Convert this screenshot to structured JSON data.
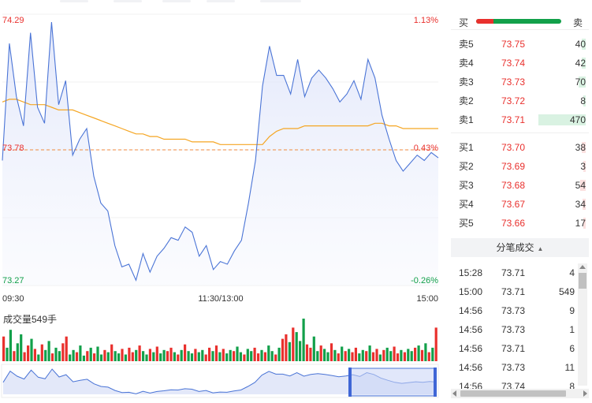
{
  "chart_data": {
    "type": "line",
    "price_axis": {
      "max_label": "74.29",
      "ref_label": "73.78",
      "min_label": "73.27"
    },
    "pct_axis": {
      "max_label": "1.13%",
      "ref_label": "0.43%",
      "min_label": "-0.26%"
    },
    "time_labels": [
      "09:30",
      "11:30/13:00",
      "15:00"
    ],
    "ylim": [
      73.27,
      74.29
    ],
    "reference_price": 73.78,
    "colors": {
      "price": "#4a74d6",
      "avg": "#f5a623",
      "up": "#e9302d",
      "down": "#12a04a",
      "ref": "#f08a3c",
      "fill": "#e9edfb"
    },
    "price_series": [
      73.74,
      74.18,
      73.98,
      73.87,
      74.22,
      73.94,
      73.88,
      74.26,
      73.95,
      74.04,
      73.76,
      73.82,
      73.86,
      73.68,
      73.58,
      73.55,
      73.42,
      73.34,
      73.35,
      73.29,
      73.39,
      73.32,
      73.38,
      73.41,
      73.45,
      73.44,
      73.49,
      73.47,
      73.38,
      73.42,
      73.33,
      73.36,
      73.35,
      73.4,
      73.44,
      73.58,
      73.74,
      74.02,
      74.17,
      74.06,
      74.06,
      73.99,
      74.12,
      73.98,
      74.05,
      74.08,
      74.05,
      74.01,
      73.96,
      73.99,
      74.04,
      73.97,
      74.12,
      74.05,
      73.91,
      73.82,
      73.74,
      73.7,
      73.73,
      73.76,
      73.74,
      73.77,
      73.75
    ],
    "avg_series": [
      73.96,
      73.97,
      73.97,
      73.96,
      73.95,
      73.95,
      73.95,
      73.94,
      73.93,
      73.93,
      73.93,
      73.92,
      73.91,
      73.9,
      73.89,
      73.88,
      73.87,
      73.86,
      73.85,
      73.84,
      73.84,
      73.83,
      73.83,
      73.82,
      73.82,
      73.82,
      73.82,
      73.81,
      73.81,
      73.81,
      73.81,
      73.8,
      73.8,
      73.8,
      73.8,
      73.8,
      73.8,
      73.8,
      73.83,
      73.85,
      73.86,
      73.86,
      73.86,
      73.87,
      73.87,
      73.87,
      73.87,
      73.87,
      73.87,
      73.87,
      73.87,
      73.87,
      73.87,
      73.88,
      73.88,
      73.87,
      73.87,
      73.86,
      73.86,
      73.86,
      73.86,
      73.86,
      73.86
    ],
    "volume": {
      "title": "成交量549手",
      "values": [
        22,
        12,
        28,
        9,
        16,
        24,
        8,
        14,
        20,
        11,
        6,
        15,
        10,
        18,
        7,
        12,
        9,
        16,
        22,
        6,
        10,
        8,
        14,
        5,
        9,
        12,
        7,
        13,
        6,
        10,
        8,
        15,
        9,
        7,
        11,
        6,
        12,
        8,
        10,
        14,
        9,
        6,
        11,
        8,
        13,
        7,
        10,
        9,
        12,
        8,
        6,
        10,
        15,
        9,
        7,
        11,
        8,
        10,
        6,
        12,
        9,
        14,
        8,
        11,
        7,
        10,
        9,
        13,
        8,
        6,
        11,
        9,
        12,
        7,
        10,
        8,
        14,
        9,
        6,
        12,
        20,
        24,
        17,
        30,
        26,
        18,
        38,
        15,
        12,
        22,
        9,
        14,
        11,
        8,
        16,
        10,
        7,
        13,
        9,
        11,
        8,
        12,
        7,
        10,
        9,
        14,
        8,
        11,
        6,
        10,
        12,
        9,
        13,
        7,
        10,
        8,
        11,
        9,
        12,
        14,
        10,
        16,
        8,
        12,
        30
      ],
      "directions": "uddudduudududdudduudduddududdududduduududdududduudududdudduudududduddudduududduduududdduudduddudududuudduduududduududdudududududdu"
    }
  },
  "book": {
    "buy_label": "买",
    "sell_label": "卖",
    "buy_ratio": 0.2,
    "asks": [
      {
        "label": "卖5",
        "price": "73.75",
        "vol": "40"
      },
      {
        "label": "卖4",
        "price": "73.74",
        "vol": "42"
      },
      {
        "label": "卖3",
        "price": "73.73",
        "vol": "70"
      },
      {
        "label": "卖2",
        "price": "73.72",
        "vol": "8"
      },
      {
        "label": "卖1",
        "price": "73.71",
        "vol": "470"
      }
    ],
    "bids": [
      {
        "label": "买1",
        "price": "73.70",
        "vol": "38"
      },
      {
        "label": "买2",
        "price": "73.69",
        "vol": "3"
      },
      {
        "label": "买3",
        "price": "73.68",
        "vol": "54"
      },
      {
        "label": "买4",
        "price": "73.67",
        "vol": "34"
      },
      {
        "label": "买5",
        "price": "73.66",
        "vol": "17"
      }
    ]
  },
  "trades": {
    "title": "分笔成交",
    "sort_icon": "caret-up-icon",
    "rows": [
      {
        "time": "15:28",
        "price": "73.71",
        "vol": "4"
      },
      {
        "time": "15:00",
        "price": "73.71",
        "vol": "549"
      },
      {
        "time": "14:56",
        "price": "73.73",
        "vol": "9"
      },
      {
        "time": "14:56",
        "price": "73.73",
        "vol": "1"
      },
      {
        "time": "14:56",
        "price": "73.71",
        "vol": "6"
      },
      {
        "time": "14:56",
        "price": "73.73",
        "vol": "11"
      },
      {
        "time": "14:56",
        "price": "73.74",
        "vol": "8"
      }
    ]
  }
}
